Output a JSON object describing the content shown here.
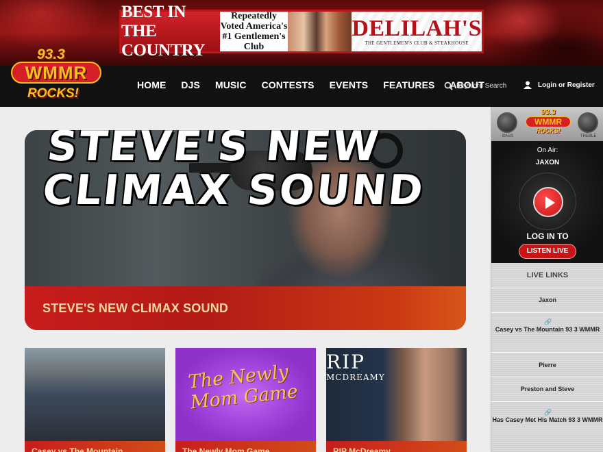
{
  "ad": {
    "left": "BEST IN THE COUNTRY",
    "mid": "Repeatedly Voted America's #1 Gentlemen's Club",
    "brand": "DELILAH'S",
    "tag": "THE GENTLEMEN'S CLUB & STEAKHOUSE"
  },
  "logo": {
    "freq": "93.3",
    "call": "WMMR",
    "slogan": "ROCKS!"
  },
  "nav": [
    "HOME",
    "DJS",
    "MUSIC",
    "CONTESTS",
    "EVENTS",
    "FEATURES",
    "ABOUT"
  ],
  "search": {
    "placeholder": "Keyword Search",
    "icon": "search-icon"
  },
  "account": {
    "label": "Login or Register",
    "icon": "user-icon"
  },
  "hero": {
    "image_text": "STEVE'S NEW CLIMAX SOUND",
    "title": "STEVE'S NEW CLIMAX SOUND"
  },
  "cards": [
    {
      "title": "Casey vs The Mountain"
    },
    {
      "image_text": "The Newly Mom Game",
      "title": "The Newly Mom Game"
    },
    {
      "image_text_1": "RIP",
      "image_text_2": "MCDREAMY",
      "title": "RIP McDreamy"
    }
  ],
  "player": {
    "bass": "BASS",
    "treble": "TREBLE",
    "on_air": "On Air:",
    "dj": "JAXON",
    "login": "LOG IN TO",
    "listen": "LISTEN LIVE"
  },
  "live_links": {
    "heading": "LIVE LINKS",
    "items": [
      "Jaxon",
      "Casey vs The Mountain 93 3 WMMR",
      "Pierre",
      "Preston and Steve",
      "Has Casey Met His Match 93 3 WMMR"
    ]
  },
  "colors": {
    "accent": "#c81414",
    "gold": "#f5c11a",
    "band_text": "#f5d9a0"
  }
}
